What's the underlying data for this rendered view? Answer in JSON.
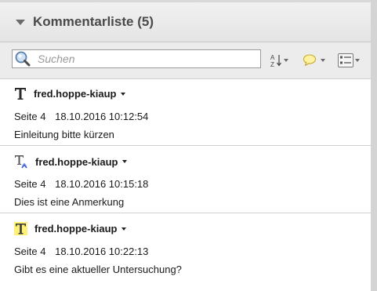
{
  "panel": {
    "title": "Kommentarliste (5)"
  },
  "search": {
    "placeholder": "Suchen"
  },
  "comments": [
    {
      "icon": "text-comment-icon",
      "author": "fred.hoppe-kiaup",
      "page": "Seite 4",
      "datetime": "18.10.2016 10:12:54",
      "text": "Einleitung bitte kürzen"
    },
    {
      "icon": "insert-text-icon",
      "author": "fred.hoppe-kiaup",
      "page": "Seite 4",
      "datetime": "18.10.2016 10:15:18",
      "text": "Dies ist eine Anmerkung"
    },
    {
      "icon": "highlight-text-icon",
      "author": "fred.hoppe-kiaup",
      "page": "Seite 4",
      "datetime": "18.10.2016 10:22:13",
      "text": "Gibt es eine aktueller Untersuchung?"
    }
  ],
  "colors": {
    "highlight": "#fff176",
    "insert_caret": "#3a5bd0"
  }
}
